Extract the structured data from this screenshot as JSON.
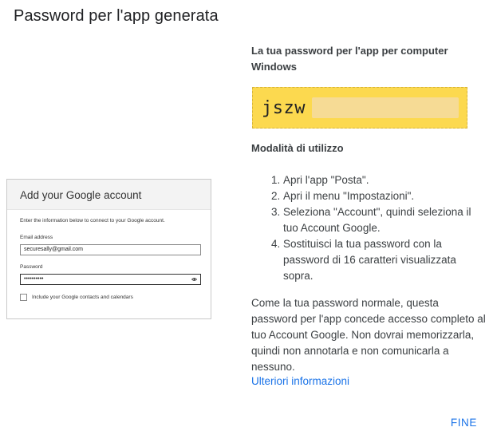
{
  "dialog": {
    "title": "Password per l'app generata"
  },
  "illustration": {
    "header": "Add your Google account",
    "intro": "Enter the information below to connect to your Google account.",
    "email_label": "Email address",
    "email_value": "securesally@gmail.com",
    "password_label": "Password",
    "password_value": "••••••••••",
    "eye_icon": "eye-icon",
    "checkbox_label": "Include your Google contacts and calendars"
  },
  "password_panel": {
    "heading": "La tua password per l'app per computer Windows",
    "visible_prefix": "jszw",
    "box_color": "#fcd94f"
  },
  "usage": {
    "heading": "Modalità di utilizzo",
    "steps": [
      {
        "num": "1.",
        "text": "Apri l'app \"Posta\"."
      },
      {
        "num": "2.",
        "text": "Apri il menu \"Impostazioni\"."
      },
      {
        "num": "3.",
        "text": "Seleziona \"Account\", quindi seleziona il tuo Account Google."
      },
      {
        "num": "4.",
        "text": "Sostituisci la tua password con la password di 16 caratteri visualizzata sopra."
      }
    ],
    "paragraph": "Come la tua password normale, questa password per l'app concede accesso completo al tuo Account Google. Non dovrai memorizzarla, quindi non annotarla e non comunicarla a nessuno.",
    "more_link": "Ulteriori informazioni"
  },
  "footer": {
    "done_label": "FINE"
  },
  "colors": {
    "accent": "#1a73e8",
    "text": "#3c4043"
  }
}
